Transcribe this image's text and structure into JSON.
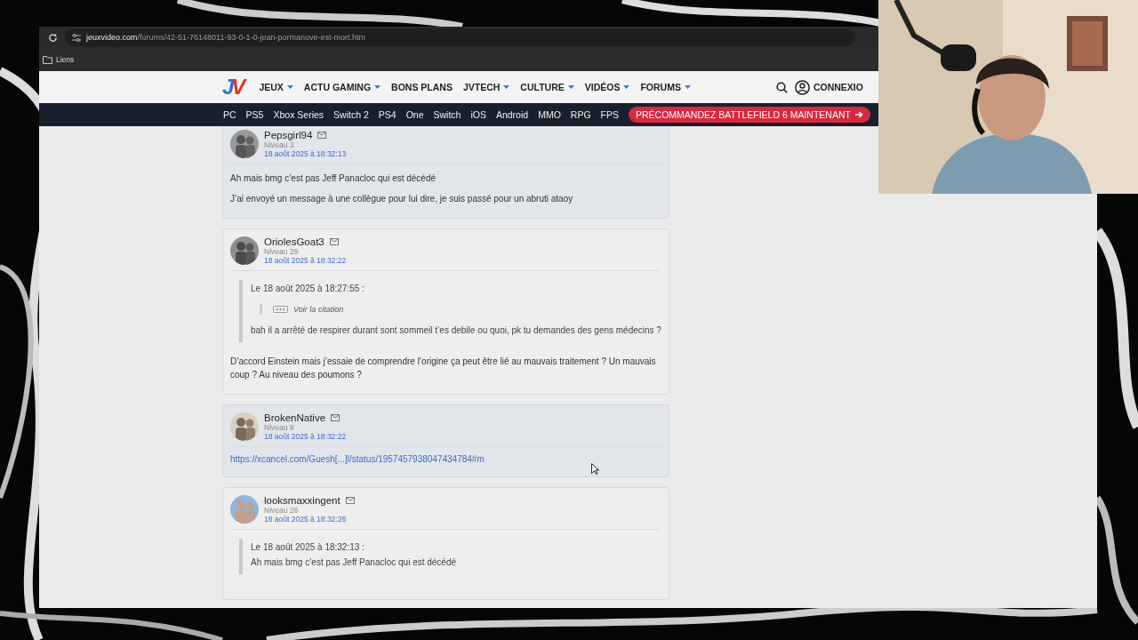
{
  "browser": {
    "url_domain": "jeuxvideo.com",
    "url_path": "/forums/42-51-76148011-93-0-1-0-jean-pormanove-est-mort.htm",
    "bookmarks": [
      {
        "label": "Liens"
      }
    ]
  },
  "site": {
    "logo": [
      {
        "text": "J",
        "color": "#2f6fd6"
      },
      {
        "text": "V",
        "color": "#e2351f"
      }
    ],
    "nav": [
      {
        "label": "JEUX",
        "dropdown": true
      },
      {
        "label": "ACTU GAMING",
        "dropdown": true
      },
      {
        "label": "BONS PLANS",
        "dropdown": false
      },
      {
        "label": "JVTECH",
        "dropdown": true
      },
      {
        "label": "CULTURE",
        "dropdown": true
      },
      {
        "label": "VIDÉOS",
        "dropdown": true
      },
      {
        "label": "FORUMS",
        "dropdown": true
      }
    ],
    "account": "CONNEXIO",
    "platforms": [
      "PC",
      "PS5",
      "Xbox Series",
      "Switch 2",
      "PS4",
      "One",
      "Switch",
      "iOS",
      "Android",
      "MMO",
      "RPG",
      "FPS"
    ],
    "promo": "PRÉCOMMANDEZ BATTLEFIELD 6 MAINTENANT"
  },
  "posts": [
    {
      "author": "Pepsgirl94",
      "level": "Niveau 3",
      "date": "18 août 2025 à 18:32:13",
      "blocks": [
        {
          "kind": "text",
          "text": "Ah mais bmg c’est pas Jeff Panacloc qui est décédé"
        },
        {
          "kind": "text",
          "text": "J’ai envoyé un message à une collègue pour lui dire, je suis passé pour un abruti ataoy"
        }
      ]
    },
    {
      "author": "OriolesGoat3",
      "level": "Niveau 29",
      "date": "18 août 2025 à 18:32:22",
      "quote": {
        "header": "Le 18 août 2025 à 18:27:55 :",
        "collapsed": "Voir la citation",
        "text": "bah il a arrêté de respirer durant sont sommeil t’es debile ou quoi, pk tu demandes des gens médecins ?"
      },
      "blocks": [
        {
          "kind": "text",
          "text": "D’accord Einstein mais j’essaie de comprendre l’origine ça peut être lié au mauvais traitement ? Un mauvais coup ? Au niveau des poumons ?"
        }
      ]
    },
    {
      "author": "BrokenNative",
      "level": "Niveau 9",
      "date": "18 août 2025 à 18:32:22",
      "blocks": [
        {
          "kind": "link",
          "text": "https://xcancel.com/Guesh[...]l/status/1957457938047434784#m"
        }
      ]
    },
    {
      "author": "looksmaxxingent",
      "level": "Niveau 26",
      "date": "18 août 2025 à 18:32:26",
      "quote": {
        "header": "Le 18 août 2025 à 18:32:13 :",
        "text": "Ah mais bmg c’est pas Jeff Panacloc qui est décédé"
      }
    }
  ]
}
